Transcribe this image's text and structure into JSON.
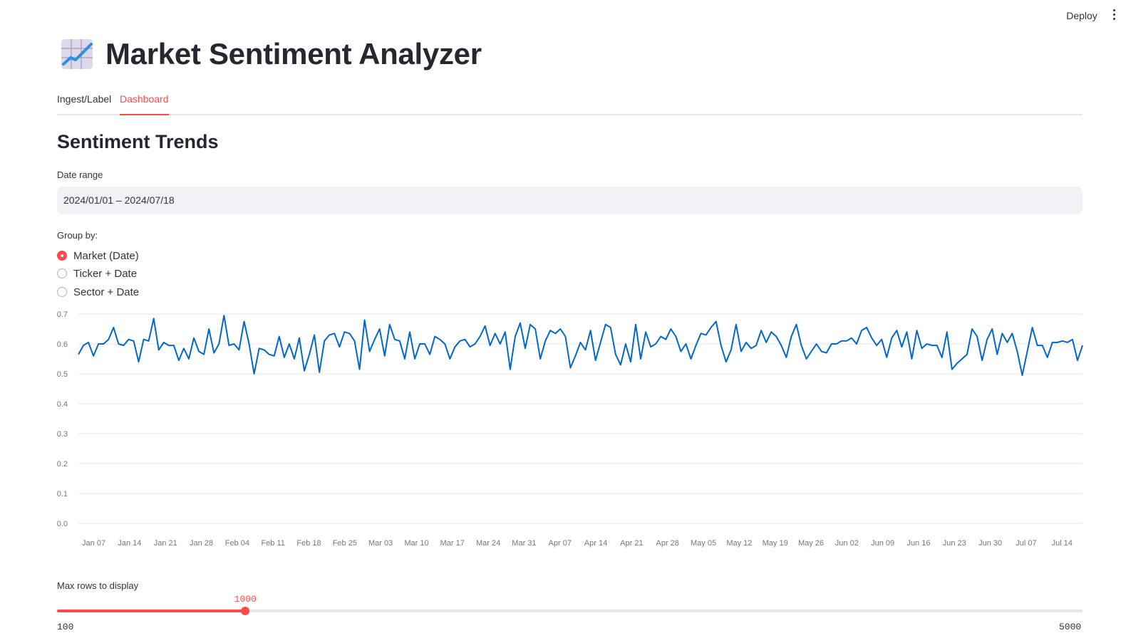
{
  "header": {
    "deploy_label": "Deploy",
    "menu_icon": "kebab-menu-icon"
  },
  "app": {
    "icon": "chart-increasing-icon",
    "title": "Market Sentiment Analyzer"
  },
  "tabs": [
    {
      "label": "Ingest/Label",
      "active": false
    },
    {
      "label": "Dashboard",
      "active": true
    }
  ],
  "section_title": "Sentiment Trends",
  "date_range": {
    "label": "Date range",
    "value": "2024/01/01 – 2024/07/18"
  },
  "group_by": {
    "label": "Group by:",
    "options": [
      "Market (Date)",
      "Ticker + Date",
      "Sector + Date"
    ],
    "selected": 0
  },
  "max_rows": {
    "label": "Max rows to display",
    "min_label": "100",
    "max_label": "5000",
    "value_label": "1000",
    "min": 100,
    "max": 5000,
    "value": 1000
  },
  "colors": {
    "accent": "#ff4b4b",
    "line": "#0068c9",
    "grid": "#e6e6ea",
    "input_bg": "#f0f2f6"
  },
  "chart_data": {
    "type": "line",
    "x_start": "2024-01-04",
    "x_end": "2024-07-18",
    "ylim": [
      0,
      0.7
    ],
    "yticks": [
      "0.0",
      "0.1",
      "0.2",
      "0.3",
      "0.4",
      "0.5",
      "0.6",
      "0.7"
    ],
    "xticks": [
      "Jan 07",
      "Jan 14",
      "Jan 21",
      "Jan 28",
      "Feb 04",
      "Feb 11",
      "Feb 18",
      "Feb 25",
      "Mar 03",
      "Mar 10",
      "Mar 17",
      "Mar 24",
      "Mar 31",
      "Apr 07",
      "Apr 14",
      "Apr 21",
      "Apr 28",
      "May 05",
      "May 12",
      "May 19",
      "May 26",
      "Jun 02",
      "Jun 09",
      "Jun 16",
      "Jun 23",
      "Jun 30",
      "Jul 07",
      "Jul 14"
    ],
    "grid": true,
    "series": [
      {
        "values": [
          0.565,
          0.595,
          0.605,
          0.56,
          0.6,
          0.6,
          0.615,
          0.655,
          0.6,
          0.595,
          0.615,
          0.61,
          0.54,
          0.615,
          0.61,
          0.685,
          0.58,
          0.605,
          0.595,
          0.595,
          0.545,
          0.585,
          0.55,
          0.62,
          0.575,
          0.565,
          0.65,
          0.57,
          0.6,
          0.695,
          0.595,
          0.6,
          0.58,
          0.675,
          0.6,
          0.5,
          0.585,
          0.58,
          0.565,
          0.56,
          0.625,
          0.555,
          0.6,
          0.55,
          0.62,
          0.51,
          0.565,
          0.63,
          0.505,
          0.61,
          0.63,
          0.635,
          0.59,
          0.64,
          0.635,
          0.61,
          0.515,
          0.68,
          0.575,
          0.615,
          0.65,
          0.56,
          0.665,
          0.615,
          0.61,
          0.55,
          0.64,
          0.55,
          0.6,
          0.6,
          0.565,
          0.625,
          0.615,
          0.6,
          0.55,
          0.59,
          0.61,
          0.615,
          0.59,
          0.6,
          0.625,
          0.66,
          0.595,
          0.635,
          0.6,
          0.64,
          0.515,
          0.625,
          0.67,
          0.585,
          0.665,
          0.65,
          0.55,
          0.61,
          0.645,
          0.635,
          0.65,
          0.625,
          0.52,
          0.56,
          0.605,
          0.58,
          0.645,
          0.545,
          0.605,
          0.665,
          0.655,
          0.565,
          0.53,
          0.6,
          0.54,
          0.665,
          0.55,
          0.64,
          0.59,
          0.6,
          0.625,
          0.615,
          0.65,
          0.625,
          0.575,
          0.6,
          0.55,
          0.595,
          0.635,
          0.63,
          0.655,
          0.675,
          0.595,
          0.54,
          0.58,
          0.665,
          0.575,
          0.605,
          0.585,
          0.595,
          0.645,
          0.605,
          0.64,
          0.625,
          0.595,
          0.555,
          0.625,
          0.665,
          0.595,
          0.55,
          0.575,
          0.6,
          0.575,
          0.57,
          0.6,
          0.6,
          0.61,
          0.61,
          0.62,
          0.6,
          0.645,
          0.655,
          0.62,
          0.595,
          0.615,
          0.555,
          0.62,
          0.645,
          0.59,
          0.64,
          0.55,
          0.645,
          0.585,
          0.6,
          0.595,
          0.595,
          0.555,
          0.64,
          0.515,
          0.535,
          0.55,
          0.565,
          0.65,
          0.625,
          0.545,
          0.615,
          0.65,
          0.565,
          0.635,
          0.605,
          0.635,
          0.575,
          0.495,
          0.575,
          0.655,
          0.595,
          0.595,
          0.555,
          0.605,
          0.605,
          0.61,
          0.605,
          0.615,
          0.545,
          0.595
        ]
      }
    ]
  }
}
